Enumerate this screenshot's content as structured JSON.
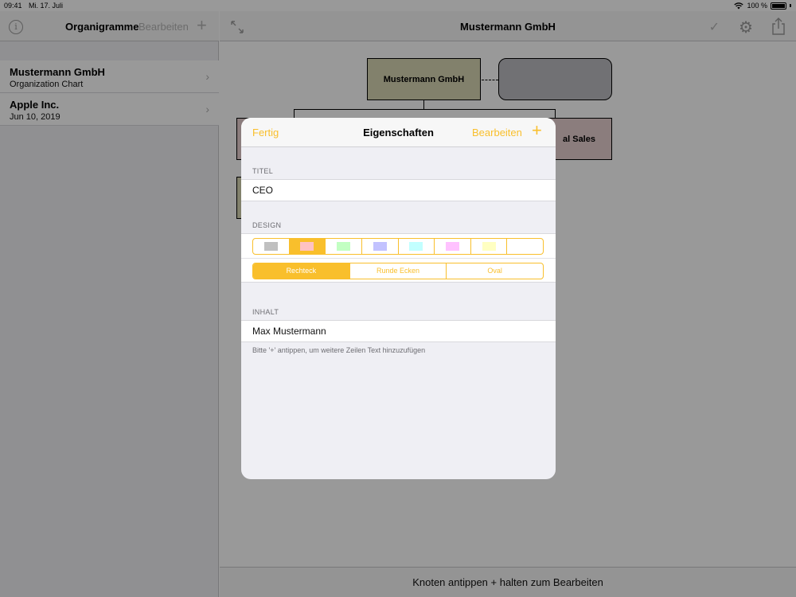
{
  "status_bar": {
    "time": "09:41",
    "date": "Mi. 17. Juli",
    "battery": "100 %"
  },
  "sidebar": {
    "title": "Organigramme",
    "edit_label": "Bearbeiten",
    "add_label": "+",
    "items": [
      {
        "title": "Mustermann GmbH",
        "subtitle": "Organization Chart"
      },
      {
        "title": "Apple Inc.",
        "subtitle": "Jun 10, 2019"
      }
    ]
  },
  "main": {
    "title": "Mustermann GmbH",
    "chart_nodes": {
      "root": "Mustermann GmbH",
      "sales_partial": "al Sales"
    },
    "footer_hint": "Knoten antippen + halten zum Bearbeiten"
  },
  "modal": {
    "done_label": "Fertig",
    "title": "Eigenschaften",
    "edit_label": "Bearbeiten",
    "add_label": "+",
    "title_section": {
      "header": "TITEL",
      "value": "CEO"
    },
    "design_section": {
      "header": "DESIGN",
      "colors": [
        "#c0c0c0",
        "#ffc2c2",
        "#c2ffc2",
        "#c2c2ff",
        "#c2ffff",
        "#ffc2ff",
        "#ffffc2",
        ""
      ],
      "selected_color_index": 1,
      "shapes": [
        "Rechteck",
        "Runde Ecken",
        "Oval"
      ],
      "selected_shape_index": 0
    },
    "content_section": {
      "header": "INHALT",
      "value": "Max Mustermann",
      "hint": "Bitte '+' antippen, um weitere Zeilen Text hinzuzufügen"
    }
  },
  "colors": {
    "accent": "#f9bf2c"
  }
}
